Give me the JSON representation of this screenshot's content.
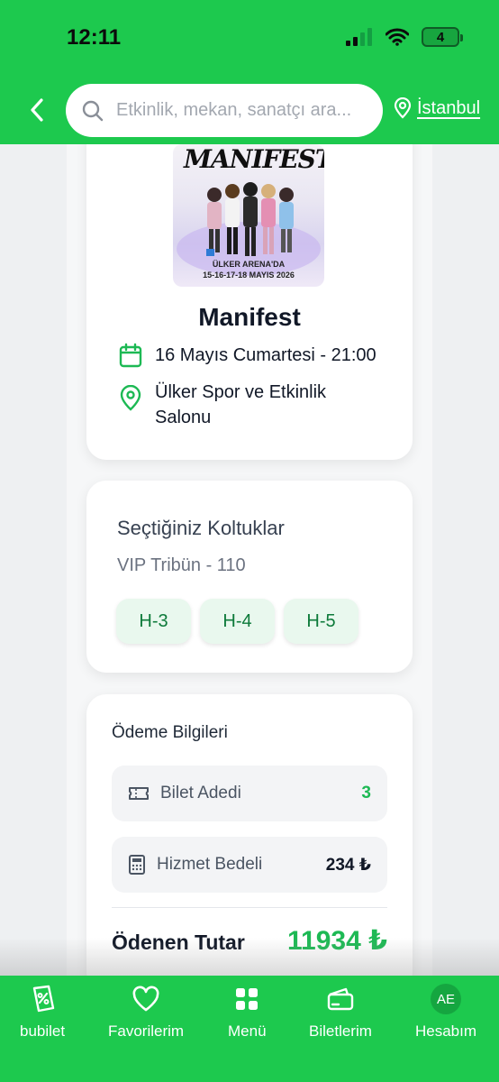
{
  "status_bar": {
    "time": "12:11",
    "battery": "4"
  },
  "header": {
    "search_placeholder": "Etkinlik, mekan, sanatçı ara...",
    "city": "İstanbul"
  },
  "event": {
    "poster": {
      "title": "MANIFEST",
      "venue_line": "ÜLKER ARENA'DA",
      "dates_line": "15-16-17-18 MAYIS 2026"
    },
    "title": "Manifest",
    "date": "16 Mayıs Cumartesi - 21:00",
    "venue_line1": "Ülker Spor ve Etkinlik",
    "venue_line2": "Salonu"
  },
  "seats": {
    "title": "Seçtiğiniz Koltuklar",
    "section": "VIP Tribün - 110",
    "list": [
      "H-3",
      "H-4",
      "H-5"
    ]
  },
  "payment": {
    "title": "Ödeme Bilgileri",
    "ticket_count_label": "Bilet Adedi",
    "ticket_count": "3",
    "service_fee_label": "Hizmet Bedeli",
    "service_fee": "234 ₺",
    "total_label": "Ödenen Tutar",
    "total": "11934 ₺"
  },
  "nav": {
    "items": [
      {
        "label": "bubilet",
        "icon": "bubilet-discount-icon"
      },
      {
        "label": "Favorilerim",
        "icon": "heart-icon"
      },
      {
        "label": "Menü",
        "icon": "grid-icon"
      },
      {
        "label": "Biletlerim",
        "icon": "wallet-icon"
      },
      {
        "label": "Hesabım",
        "icon": "avatar"
      }
    ],
    "avatar_initials": "AE"
  },
  "colors": {
    "brand_green": "#1dc94e",
    "accent_green": "#1db954",
    "chip_bg": "#e9f8ee"
  }
}
